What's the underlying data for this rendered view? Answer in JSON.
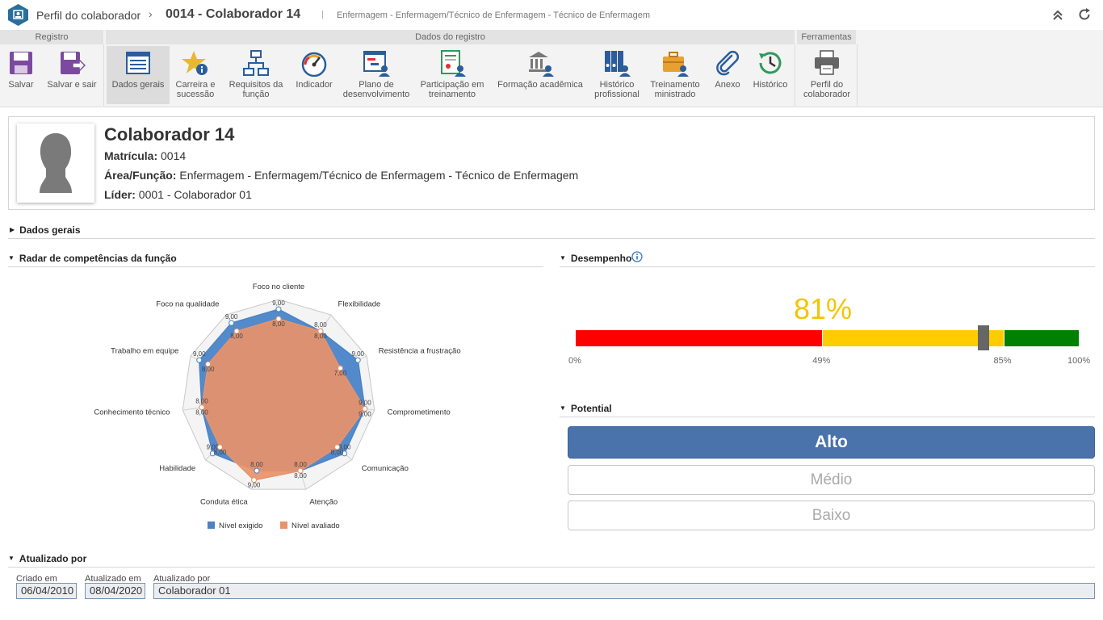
{
  "title": {
    "app_name": "Perfil do colaborador",
    "chevron": "›",
    "record": "0014 - Colaborador 14",
    "separator": "|",
    "subtitle": "Enfermagem - Enfermagem/Técnico de Enfermagem - Técnico de Enfermagem"
  },
  "ribbon": {
    "groups": [
      "Registro",
      "Dados do registro",
      "Ferramentas"
    ],
    "buttons": [
      {
        "l1": "Salvar",
        "l2": ""
      },
      {
        "l1": "Salvar e sair",
        "l2": ""
      },
      {
        "l1": "Dados gerais",
        "l2": ""
      },
      {
        "l1": "Carreira e",
        "l2": "sucessão"
      },
      {
        "l1": "Requisitos da",
        "l2": "função"
      },
      {
        "l1": "Indicador",
        "l2": ""
      },
      {
        "l1": "Plano de",
        "l2": "desenvolvimento"
      },
      {
        "l1": "Participação em",
        "l2": "treinamento"
      },
      {
        "l1": "Formação acadêmica",
        "l2": ""
      },
      {
        "l1": "Histórico",
        "l2": "profissional"
      },
      {
        "l1": "Treinamento",
        "l2": "ministrado"
      },
      {
        "l1": "Anexo",
        "l2": ""
      },
      {
        "l1": "Histórico",
        "l2": ""
      },
      {
        "l1": "Perfil do",
        "l2": "colaborador"
      }
    ]
  },
  "profile": {
    "name": "Colaborador 14",
    "matricula_label": "Matrícula:",
    "matricula": "0014",
    "area_label": "Área/Função:",
    "area": "Enfermagem - Enfermagem/Técnico de Enfermagem - Técnico de Enfermagem",
    "lider_label": "Líder:",
    "lider": "0001 - Colaborador 01"
  },
  "sections": {
    "dados_gerais": "Dados gerais",
    "radar": "Radar de competências da função",
    "desempenho": "Desempenho",
    "potential": "Potential",
    "atualizado": "Atualizado por"
  },
  "chart_data": {
    "type": "radar",
    "categories": [
      "Foco no cliente",
      "Flexibilidade",
      "Resistência a frustração",
      "Comprometimento",
      "Comunicação",
      "Atenção",
      "Conduta ética",
      "Habilidade",
      "Conhecimento técnico",
      "Trabalho em equipe",
      "Foco na qualidade"
    ],
    "series": [
      {
        "name": "Nível exigido",
        "values": [
          9,
          8,
          9,
          9,
          9,
          8,
          8,
          9,
          8,
          9,
          9
        ],
        "labels": [
          "9,00",
          "8,00",
          "9,00",
          "9,00",
          "9,00",
          "8,00",
          "8,00",
          "9,00",
          "8,00",
          "9,00",
          "9,00"
        ],
        "color": "#4a84c8"
      },
      {
        "name": "Nível avaliado",
        "values": [
          8,
          8,
          7,
          9,
          8,
          8,
          9,
          8,
          8,
          8,
          8
        ],
        "labels": [
          "8,00",
          "8,00",
          "7,00",
          "9,00",
          "8,00",
          "8,00",
          "9,00",
          "8,00",
          "8,00",
          "8,00",
          "8,00"
        ],
        "color": "#e8936a"
      }
    ],
    "rmax": 10,
    "rings": 5
  },
  "performance": {
    "value_text": "81%",
    "value": 81,
    "ticks": [
      {
        "value": 0,
        "label": "0%"
      },
      {
        "value": 49,
        "label": "49%"
      },
      {
        "value": 85,
        "label": "85%"
      },
      {
        "value": 100,
        "label": "100%"
      }
    ],
    "colors": {
      "red": "#ff0000",
      "yellow": "#ffcc00",
      "green": "#008000"
    }
  },
  "potential": {
    "options": [
      "Alto",
      "Médio",
      "Baixo"
    ],
    "selected": "Alto"
  },
  "updated": {
    "created_label": "Criado em",
    "created": "06/04/2010",
    "updated_label": "Atualizado em",
    "updated": "08/04/2020",
    "by_label": "Atualizado por",
    "by": "Colaborador 01"
  }
}
